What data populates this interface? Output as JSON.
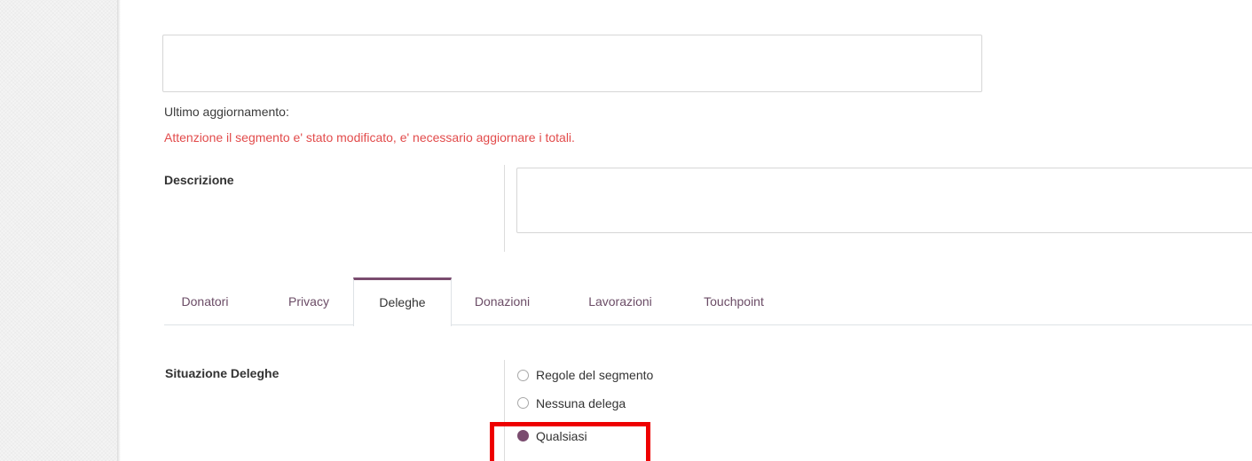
{
  "segment": {
    "name_value": "",
    "last_update_label": "Ultimo aggiornamento:",
    "warning_text": "Attenzione il segmento e' stato modificato, e' necessario aggiornare i totali."
  },
  "description": {
    "label": "Descrizione",
    "value": ""
  },
  "tabs": [
    {
      "label": "Donatori",
      "active": false
    },
    {
      "label": "Privacy",
      "active": false
    },
    {
      "label": "Deleghe",
      "active": true
    },
    {
      "label": "Donazioni",
      "active": false
    },
    {
      "label": "Lavorazioni",
      "active": false
    },
    {
      "label": "Touchpoint",
      "active": false
    }
  ],
  "deleghe": {
    "label": "Situazione Deleghe",
    "options": [
      {
        "label": "Regole del segmento",
        "checked": false
      },
      {
        "label": "Nessuna delega",
        "checked": false
      },
      {
        "label": "Qualsiasi",
        "checked": true
      }
    ]
  },
  "colors": {
    "accent": "#7a4c6f",
    "warning": "#e24b4b",
    "highlight": "#ee0000"
  }
}
